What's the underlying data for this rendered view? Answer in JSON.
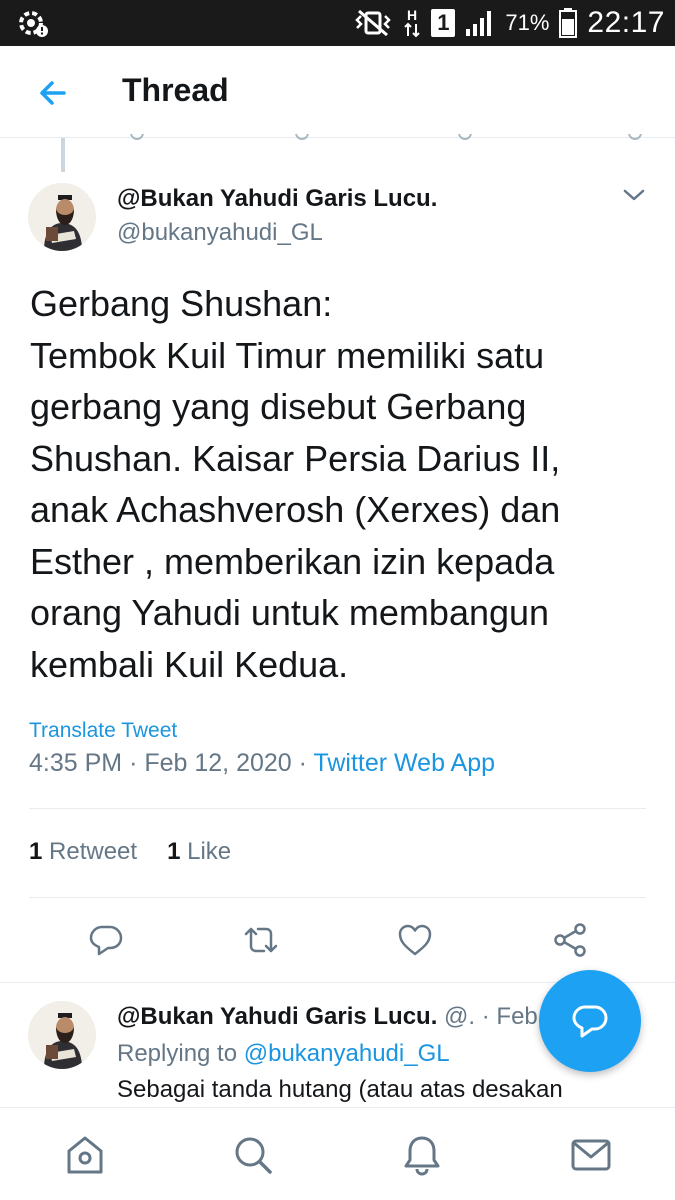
{
  "status_bar": {
    "battery_percent": "71%",
    "time": "22:17",
    "sim_label": "1",
    "network_type": "H"
  },
  "header": {
    "title": "Thread"
  },
  "main_tweet": {
    "author_name": "@Bukan Yahudi Garis Lucu.",
    "author_handle": "@bukanyahudi_GL",
    "text_lines": [
      "Gerbang Shushan:",
      "Tembok Kuil Timur memiliki satu",
      "gerbang yang disebut Gerbang",
      "Shushan. Kaisar Persia Darius II,",
      "anak Achashverosh (Xerxes) dan",
      "Esther , memberikan izin kepada",
      "orang Yahudi untuk membangun",
      "kembali Kuil Kedua."
    ],
    "translate_label": "Translate Tweet",
    "time": "4:35 PM",
    "date": "Feb 12, 2020",
    "separator": "·",
    "source_app": "Twitter Web App",
    "retweet_count": "1",
    "retweet_label": "Retweet",
    "like_count": "1",
    "like_label": "Like"
  },
  "reply_tweet": {
    "author_name": "@Bukan Yahudi Garis Lucu.",
    "handle_truncated": "@.",
    "separator": "·",
    "date_truncated": "Feb",
    "replying_prefix": "Replying to",
    "replying_handle": "@bukanyahudi_GL",
    "text_preview": "Sebagai tanda hutang (atau atas desakan"
  },
  "colors": {
    "accent": "#1da1f2",
    "link": "#1b95e0",
    "text_primary": "#14171a",
    "text_secondary": "#657786",
    "divider": "#e6ecf0",
    "status_bar_bg": "#1a1a1a"
  },
  "icons": {
    "back": "arrow-left-icon",
    "caret": "chevron-down-icon",
    "reply": "reply-bubble-icon",
    "retweet": "retweet-icon",
    "like": "heart-icon",
    "share": "share-icon",
    "compose": "compose-reply-icon",
    "nav_home": "home-icon",
    "nav_search": "search-icon",
    "nav_notifications": "bell-icon",
    "nav_messages": "mail-icon"
  }
}
